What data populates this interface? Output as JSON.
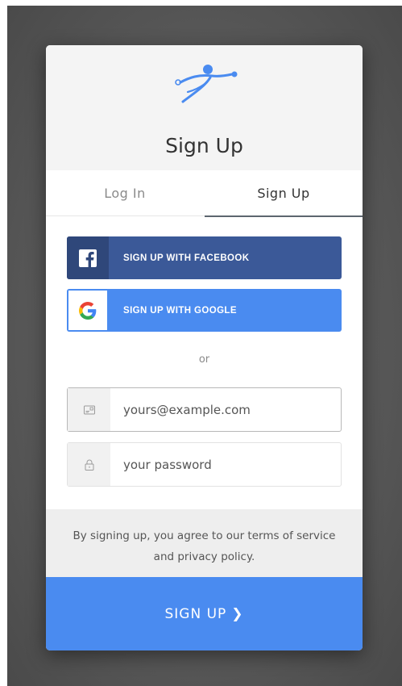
{
  "header": {
    "title": "Sign Up"
  },
  "tabs": [
    {
      "label": "Log In",
      "active": false
    },
    {
      "label": "Sign Up",
      "active": true
    }
  ],
  "social": {
    "facebook_label": "SIGN UP WITH FACEBOOK",
    "google_label": "SIGN UP WITH GOOGLE"
  },
  "divider_text": "or",
  "form": {
    "email_placeholder": "yours@example.com",
    "email_value": "",
    "password_placeholder": "your password",
    "password_value": ""
  },
  "terms": {
    "line1": "By signing up, you agree to our terms of service",
    "line2": "and privacy policy."
  },
  "submit": {
    "label": "SIGN UP",
    "chevron": "❯"
  },
  "icons": {
    "logo": "runner-logo-icon",
    "facebook": "facebook-icon",
    "google": "google-icon",
    "email": "email-card-icon",
    "password": "lock-icon"
  },
  "colors": {
    "accent": "#4a8bf0",
    "facebook": "#3b5998",
    "facebook_dark": "#2f477a",
    "header_bg": "#f4f4f4",
    "terms_bg": "#eeeeee"
  }
}
